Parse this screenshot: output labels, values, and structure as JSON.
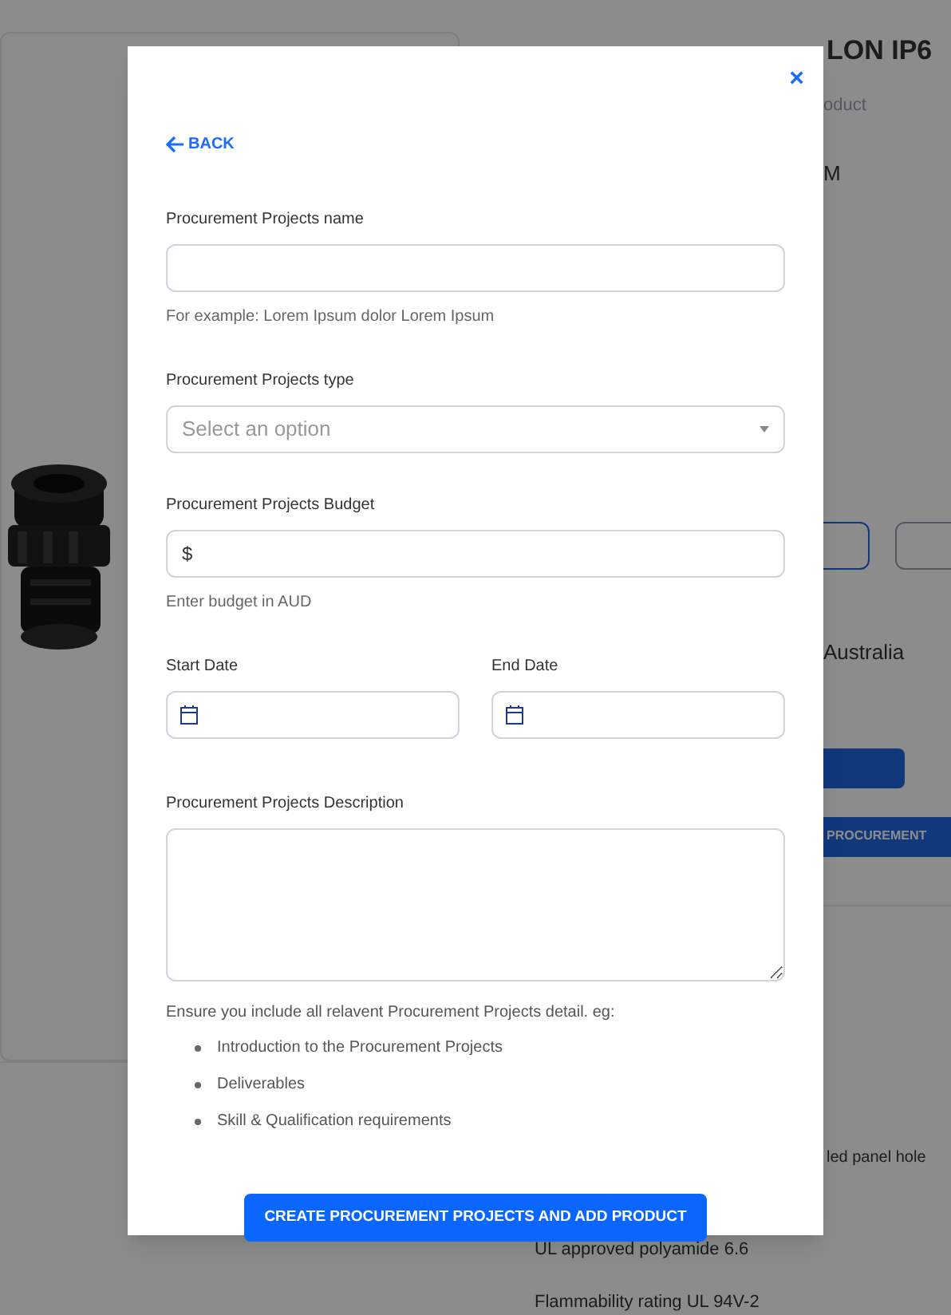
{
  "page": {
    "title": "LON IP6",
    "subtitle": "oduct",
    "code": "M",
    "location": "Australia",
    "procurement_button": "PROCUREMENT",
    "description": "led panel hole",
    "features": [
      "UL approved polyamide 6.6",
      "Flammability rating UL 94V-2"
    ],
    "product_image": {
      "kind": "picture"
    }
  },
  "modal": {
    "close": "×",
    "back": "BACK",
    "fields": [
      {
        "kind": "text",
        "label": "Procurement Projects name",
        "hint": "For example: Lorem Ipsum dolor Lorem Ipsum"
      },
      {
        "kind": "select",
        "label": "Procurement Projects type",
        "placeholder": "Select an option"
      },
      {
        "kind": "money",
        "label": "Procurement Projects Budget",
        "prefix": "$",
        "hint": "Enter budget in AUD"
      },
      {
        "kind": "dates",
        "items": [
          {
            "label": "Start Date"
          },
          {
            "label": "End Date"
          }
        ]
      },
      {
        "kind": "textarea",
        "label": "Procurement Projects Description"
      }
    ],
    "guidance": "Ensure you include all relavent Procurement Projects detail. eg:",
    "guidance_items": [
      "Introduction to the Procurement Projects",
      "Deliverables",
      "Skill & Qualification requirements"
    ],
    "submit": "CREATE PROCUREMENT PROJECTS AND ADD PRODUCT"
  }
}
